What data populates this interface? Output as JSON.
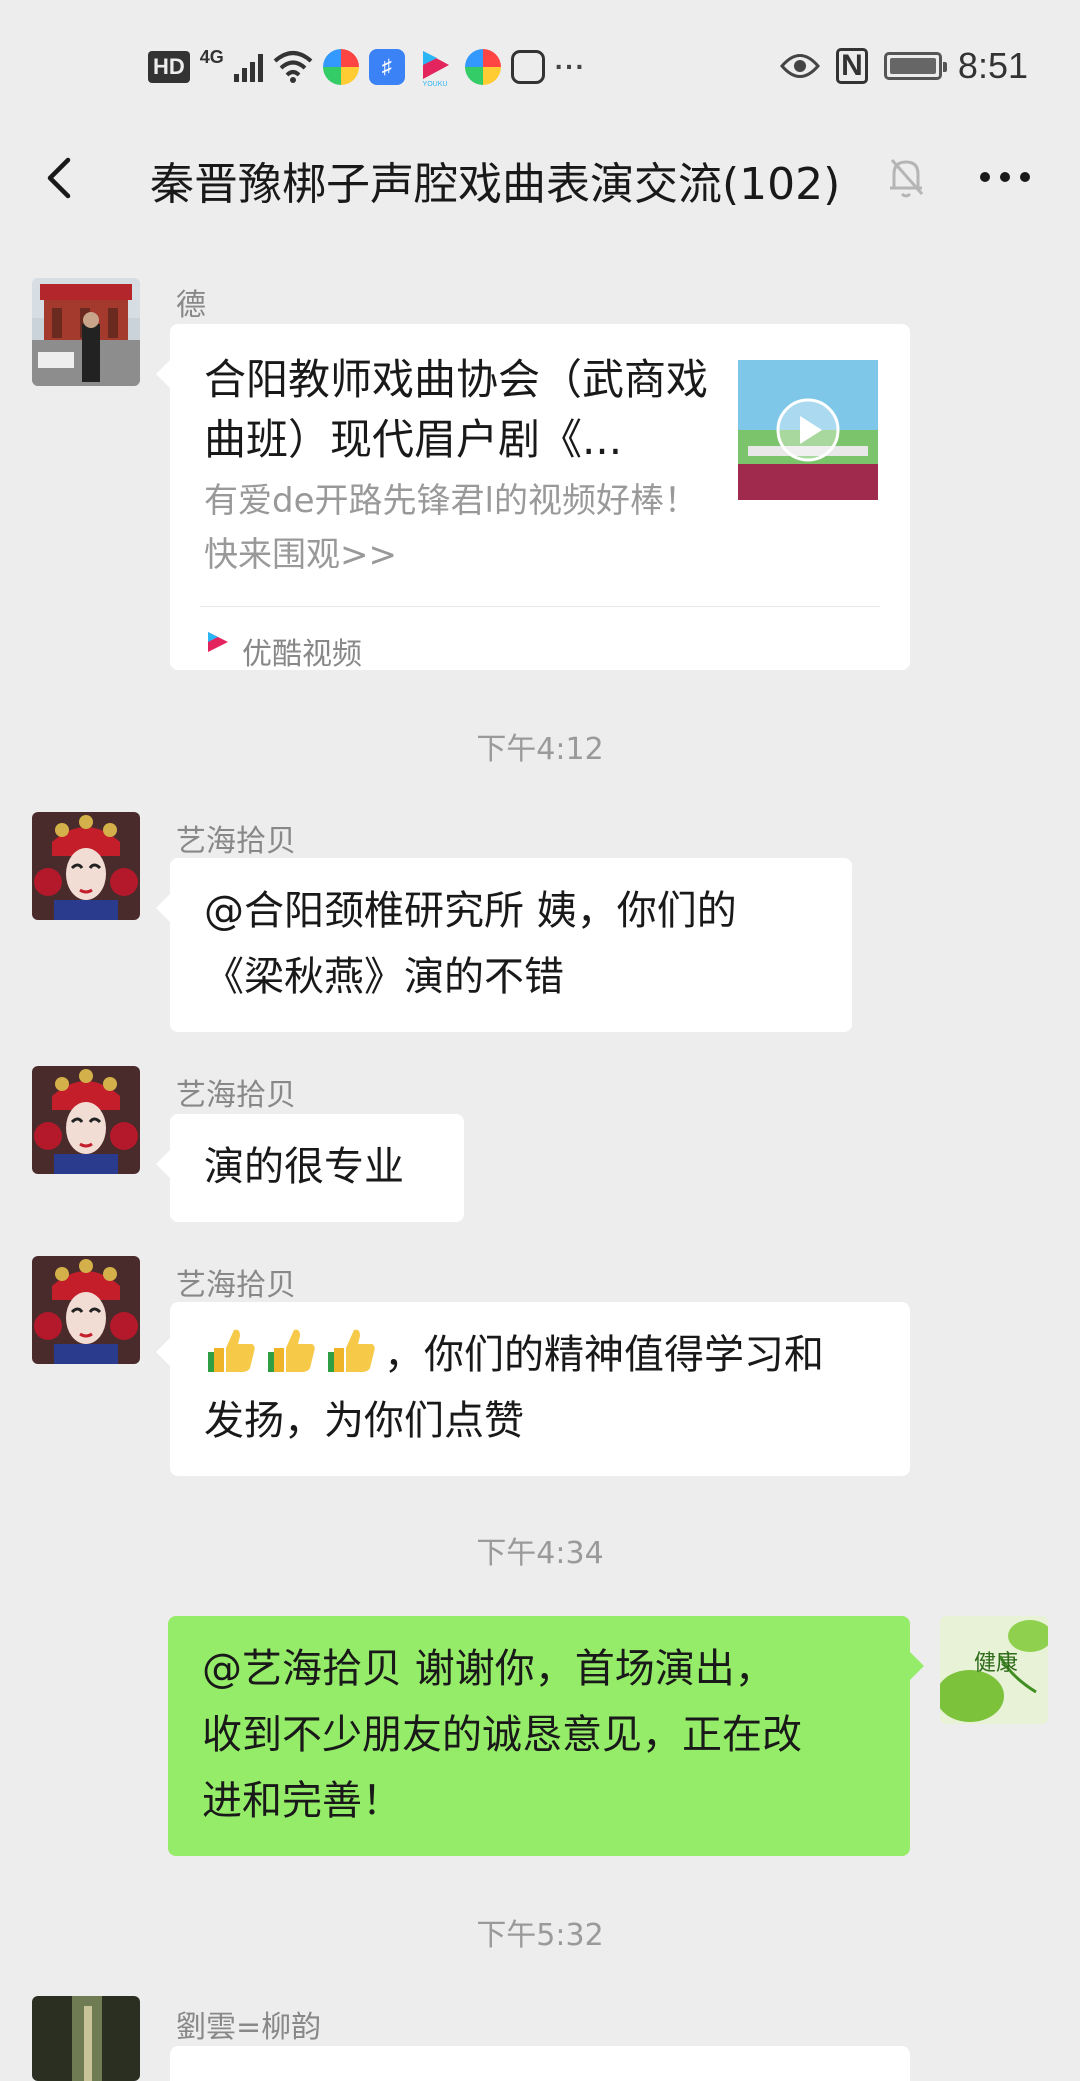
{
  "status_bar": {
    "hd": "HD",
    "network": "4G",
    "time": "8:51",
    "more": "···",
    "nfc": "N",
    "icons": [
      "signal-icon",
      "wifi-icon",
      "app-icon",
      "youku-icon",
      "eye-icon",
      "nfc-icon",
      "battery-icon"
    ]
  },
  "header": {
    "title": "秦晋豫梆子声腔戏曲表演交流(102)",
    "back_icon": "chevron-left-icon",
    "mute_icon": "bell-off-icon",
    "more_icon": "more-icon"
  },
  "messages": [
    {
      "sender": "德",
      "type": "link",
      "card": {
        "title": "合阳教师戏曲协会（武商戏曲班）现代眉户剧《...",
        "desc": "有爱de开路先锋君l的视频好棒！快来围观>>",
        "source": "优酷视频"
      }
    },
    {
      "time": "下午4:12"
    },
    {
      "sender": "艺海拾贝",
      "type": "text",
      "text_line1": "@合阳颈椎研究所  姨，你们的",
      "text_line2": "《梁秋燕》演的不错"
    },
    {
      "sender": "艺海拾贝",
      "type": "text",
      "text": "演的很专业"
    },
    {
      "sender": "艺海拾贝",
      "type": "text",
      "emoji": "thumbs-up-icon",
      "text_line1": "，你们的精神值得学习和",
      "text_line2": "发扬，为你们点赞"
    },
    {
      "time": "下午4:34"
    },
    {
      "sender": "self",
      "type": "text",
      "text_line1": "@艺海拾贝  谢谢你，首场演出，",
      "text_line2": "收到不少朋友的诚恳意见，正在改",
      "text_line3": "进和完善！"
    },
    {
      "time": "下午5:32"
    },
    {
      "sender": "劉雲=柳韵",
      "type": "text"
    }
  ],
  "colors": {
    "background": "#ededed",
    "bubble_incoming": "#ffffff",
    "bubble_outgoing": "#95ec69",
    "meta_text": "#888888"
  }
}
